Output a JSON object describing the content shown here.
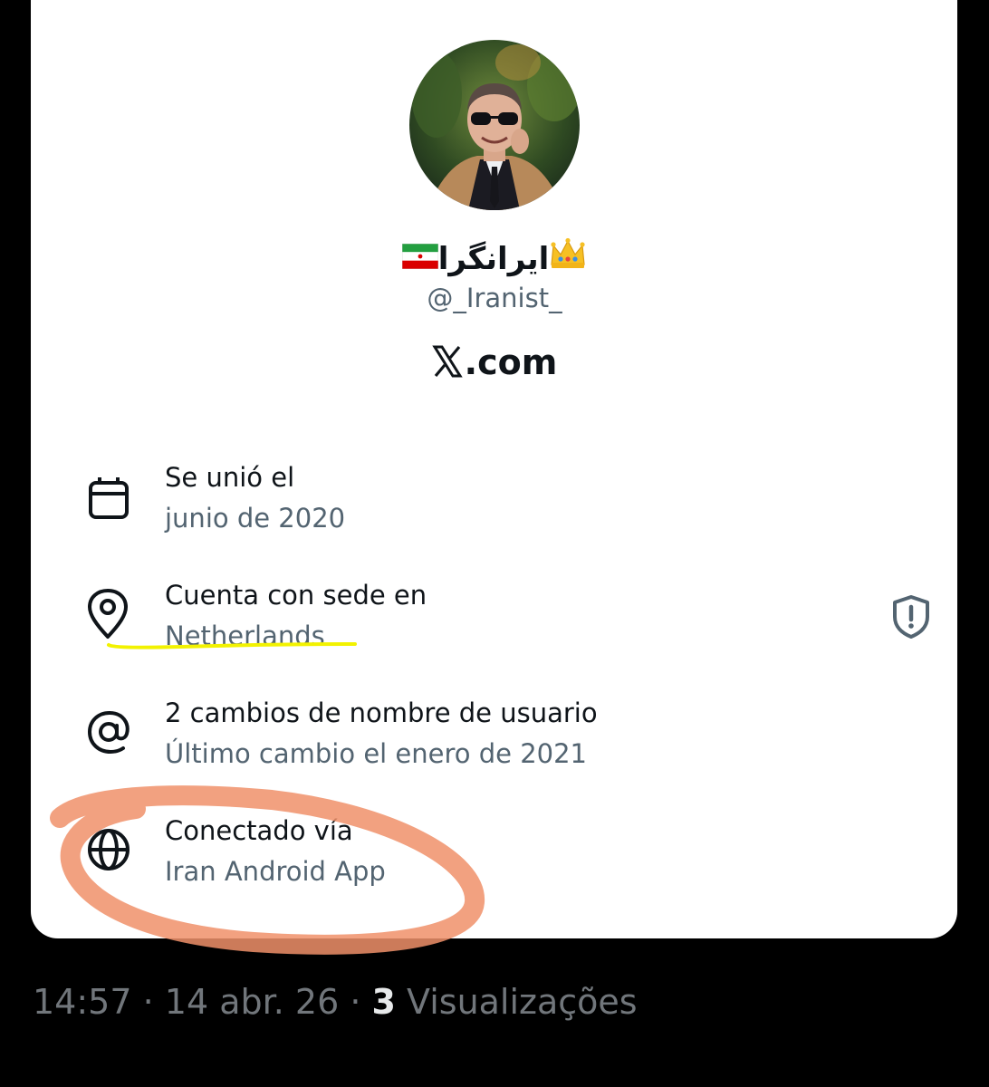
{
  "profile": {
    "display_name": "ایرانگرا",
    "handle": "@_Iranist_",
    "site": ".com",
    "avatar_alt": "profile-photo"
  },
  "about": {
    "rows": [
      {
        "title": "Se unió el",
        "sub": "junio de 2020",
        "icon": "calendar-icon"
      },
      {
        "title": "Cuenta con sede en",
        "sub": "Netherlands",
        "icon": "location-pin-icon"
      },
      {
        "title": "2 cambios de nombre de usuario",
        "sub": "Último cambio el enero de 2021",
        "icon": "at-sign-icon"
      },
      {
        "title": "Conectado vía",
        "sub": "Iran Android App",
        "icon": "globe-icon"
      }
    ],
    "shield_icon": "shield-alert-icon"
  },
  "footer": {
    "time": "14:57",
    "sep1": " · ",
    "date": "14 abr. 26",
    "sep2": " · ",
    "views_count": "3",
    "views_label": " Visualizações"
  },
  "colors": {
    "background": "#000000",
    "card": "#ffffff",
    "text_primary": "#0f1419",
    "text_secondary": "#536471",
    "highlight_yellow": "#f2f200",
    "annotation_orange": "#f0916a"
  }
}
